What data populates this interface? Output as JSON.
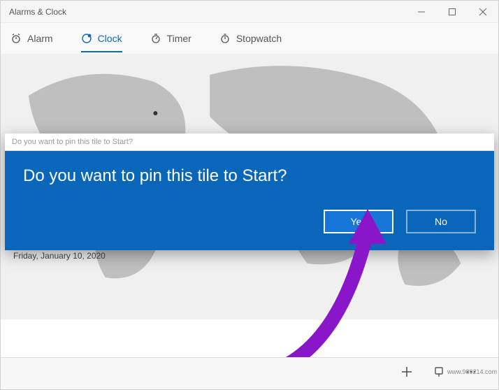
{
  "window": {
    "title": "Alarms & Clock",
    "controls": {
      "minimize": "minimize",
      "maximize": "maximize",
      "close": "close"
    }
  },
  "tabs": [
    {
      "label": "Alarm",
      "icon": "alarm-icon"
    },
    {
      "label": "Clock",
      "icon": "clock-icon",
      "active": true
    },
    {
      "label": "Timer",
      "icon": "timer-icon"
    },
    {
      "label": "Stopwatch",
      "icon": "stopwatch-icon"
    }
  ],
  "date": "Friday, January 10, 2020",
  "dialog": {
    "title": "Do you want to pin this tile to Start?",
    "message": "Do you want to pin this tile to Start?",
    "yes_label": "Yes",
    "no_label": "No"
  },
  "bottombar": {
    "add": "add",
    "pin": "pin",
    "more": "more"
  },
  "watermark": "www.989214.com"
}
